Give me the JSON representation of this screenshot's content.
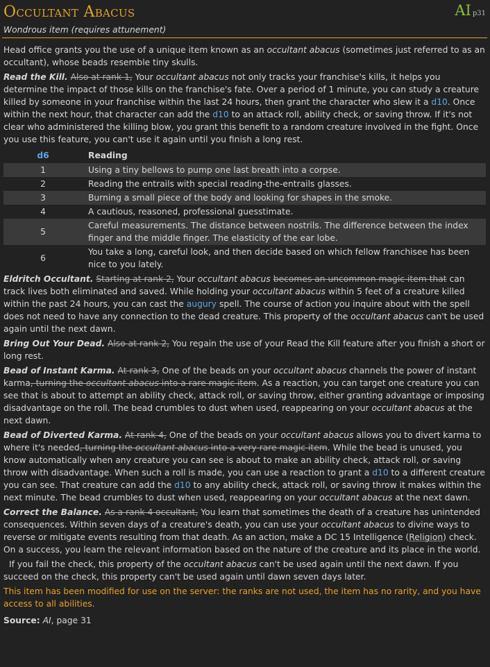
{
  "item": {
    "name": "Occultant Abacus",
    "source_abbr": "AI",
    "source_page": "p31",
    "subtitle": "Wondrous item (requires attunement)"
  },
  "intro": {
    "a": "Head office grants you the use of a unique item known as an ",
    "em": "occultant abacus",
    "b": " (sometimes just referred to as an occultant), whose beads resemble tiny skulls."
  },
  "read_kill": {
    "name": "Read the Kill.",
    "strike": "Also at rank 1,",
    "t1": " Your ",
    "em1": "occultant abacus",
    "t2": " not only tracks your franchise's kills, it helps you determine the impact of those kills on the franchise's fate. Over a period of 1 minute, you can study a creature killed by someone in your franchise within the last 24 hours, then grant the character who slew it a ",
    "d10a": "d10",
    "t3": ". Once within the next hour, that character can add the ",
    "d10b": "d10",
    "t4": " to an attack roll, ability check, or saving throw. If it's not clear who administered the killing blow, you grant this benefit to a random creature involved in the fight. Once you use this feature, you can't use it again until you finish a long rest."
  },
  "table": {
    "col1": "d6",
    "col2": "Reading",
    "rows": [
      {
        "n": "1",
        "text": "Using a tiny bellows to pump one last breath into a corpse."
      },
      {
        "n": "2",
        "text": "Reading the entrails with special reading-the-entrails glasses."
      },
      {
        "n": "3",
        "text": "Burning a small piece of the body and looking for shapes in the smoke."
      },
      {
        "n": "4",
        "text": "A cautious, reasoned, professional guesstimate."
      },
      {
        "n": "5",
        "text": "Careful measurements. The distance between nostrils. The difference between the index finger and the middle finger. The elasticity of the ear lobe."
      },
      {
        "n": "6",
        "text": "You take a long, careful look, and then decide based on which fellow franchisee has been nice to you lately."
      }
    ]
  },
  "eldritch": {
    "name": "Eldritch Occultant.",
    "strike1": "Starting at rank 2,",
    "t1": " Your ",
    "em1": "occultant abacus",
    "strike2": "becomes an uncommon magic item that",
    "t2": " can track lives both eliminated and saved. While holding your ",
    "em2": "occultant abacus",
    "t3": " within 5 feet of a creature killed within the past 24 hours, you can cast the ",
    "spell": "augury",
    "t4": " spell. The course of action you inquire about with the spell does not need to have any connection to the dead creature. This property of the ",
    "em3": "occultant abacus",
    "t5": " can't be used again until the next dawn."
  },
  "bring_out": {
    "name": "Bring Out Your Dead.",
    "strike": "Also at rank 2,",
    "t1": " You regain the use of your Read the Kill feature after you finish a short or long rest."
  },
  "instant": {
    "name": "Bead of Instant Karma.",
    "strike1": "At rank 3,",
    "t1": " One of the beads on your ",
    "em1": "occultant abacus",
    "t2": " channels the power of instant karma",
    "strike2a": ", turning the ",
    "strike2em": "occultant abacus",
    "strike2b": " into a rare magic item",
    "t3": ". As a reaction, you can target one creature you can see that is about to attempt an ability check, attack roll, or saving throw, either granting advantage or imposing disadvantage on the roll. The bead crumbles to dust when used, reappearing on your ",
    "em2": "occultant abacus",
    "t4": " at the next dawn."
  },
  "diverted": {
    "name": "Bead of Diverted Karma.",
    "strike1": "At rank 4,",
    "t1": " One of the beads on your ",
    "em1": "occultant abacus",
    "t2": " allows you to divert karma to where it's needed",
    "strike2a": ", turning the ",
    "strike2em": "occultant abacus",
    "strike2b": " into a very rare magic item",
    "t3": ". While the bead is unused, you know automatically when any creature you can see is about to make an ability check, attack roll, or saving throw with disadvantage. When such a roll is made, you can use a reaction to grant a ",
    "d10a": "d10",
    "t4": " to a different creature you can see. That creature can add the ",
    "d10b": "d10",
    "t5": " to any ability check, attack roll, or saving throw it makes within the next minute. The bead crumbles to dust when used, reappearing on your ",
    "em2": "occultant abacus",
    "t6": " at the next dawn."
  },
  "balance": {
    "name": "Correct the Balance.",
    "strike": "As a rank 4 occultant,",
    "t1": " You learn that sometimes the death of a creature has unintended consequences. Within seven days of a creature's death, you can use your ",
    "em1": "occultant abacus",
    "t2": " to divine ways to reverse or mitigate events resulting from that death. As an action, make a DC 15 Intelligence (",
    "skill": "Religion",
    "t3": ") check. On a success, you learn the relevant information based on the nature of the creature and its place in the world.",
    "p2a": "If you fail the check, this property of the ",
    "p2em": "occultant abacus",
    "p2b": " can't be used again until the next dawn. If you succeed on the check, this property can't be used again until dawn seven days later."
  },
  "note": "This item has been modified for use on the server: the ranks are not used, the item has no rarity, and you have access to all abilities.",
  "source": {
    "label": "Source:",
    "book": "AI",
    "page": ", page 31"
  }
}
